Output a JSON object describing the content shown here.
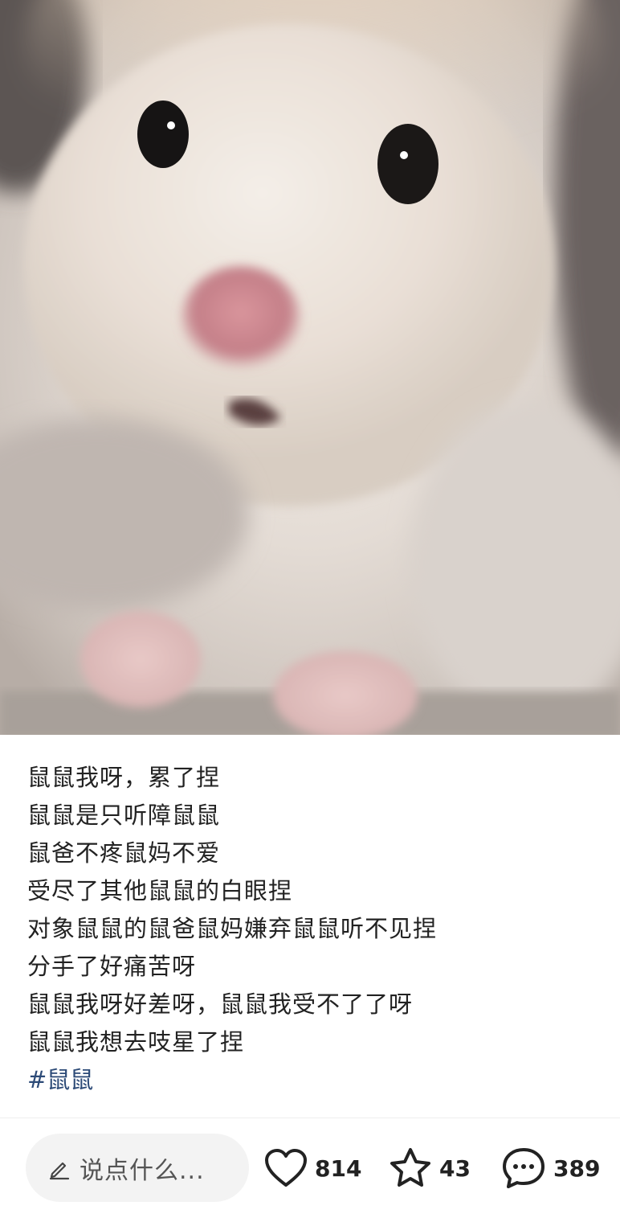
{
  "photo": {
    "subject": "hamster-closeup-photo"
  },
  "post": {
    "lines": [
      "鼠鼠我呀，累了捏",
      "鼠鼠是只听障鼠鼠",
      "鼠爸不疼鼠妈不爱",
      "受尽了其他鼠鼠的白眼捏",
      "对象鼠鼠的鼠爸鼠妈嫌弃鼠鼠听不见捏",
      "分手了好痛苦呀",
      "鼠鼠我呀好差呀，鼠鼠我受不了了呀",
      "鼠鼠我想去吱星了捏"
    ],
    "tag": "#鼠鼠"
  },
  "bottombar": {
    "comment_placeholder": "说点什么...",
    "likes": "814",
    "favorites": "43",
    "comments": "389"
  },
  "colors": {
    "tag": "#2c4a77",
    "text": "#222222",
    "input_bg": "#f3f3f3"
  },
  "icons": [
    "pen-icon",
    "heart-icon",
    "star-icon",
    "comment-bubble-icon"
  ]
}
